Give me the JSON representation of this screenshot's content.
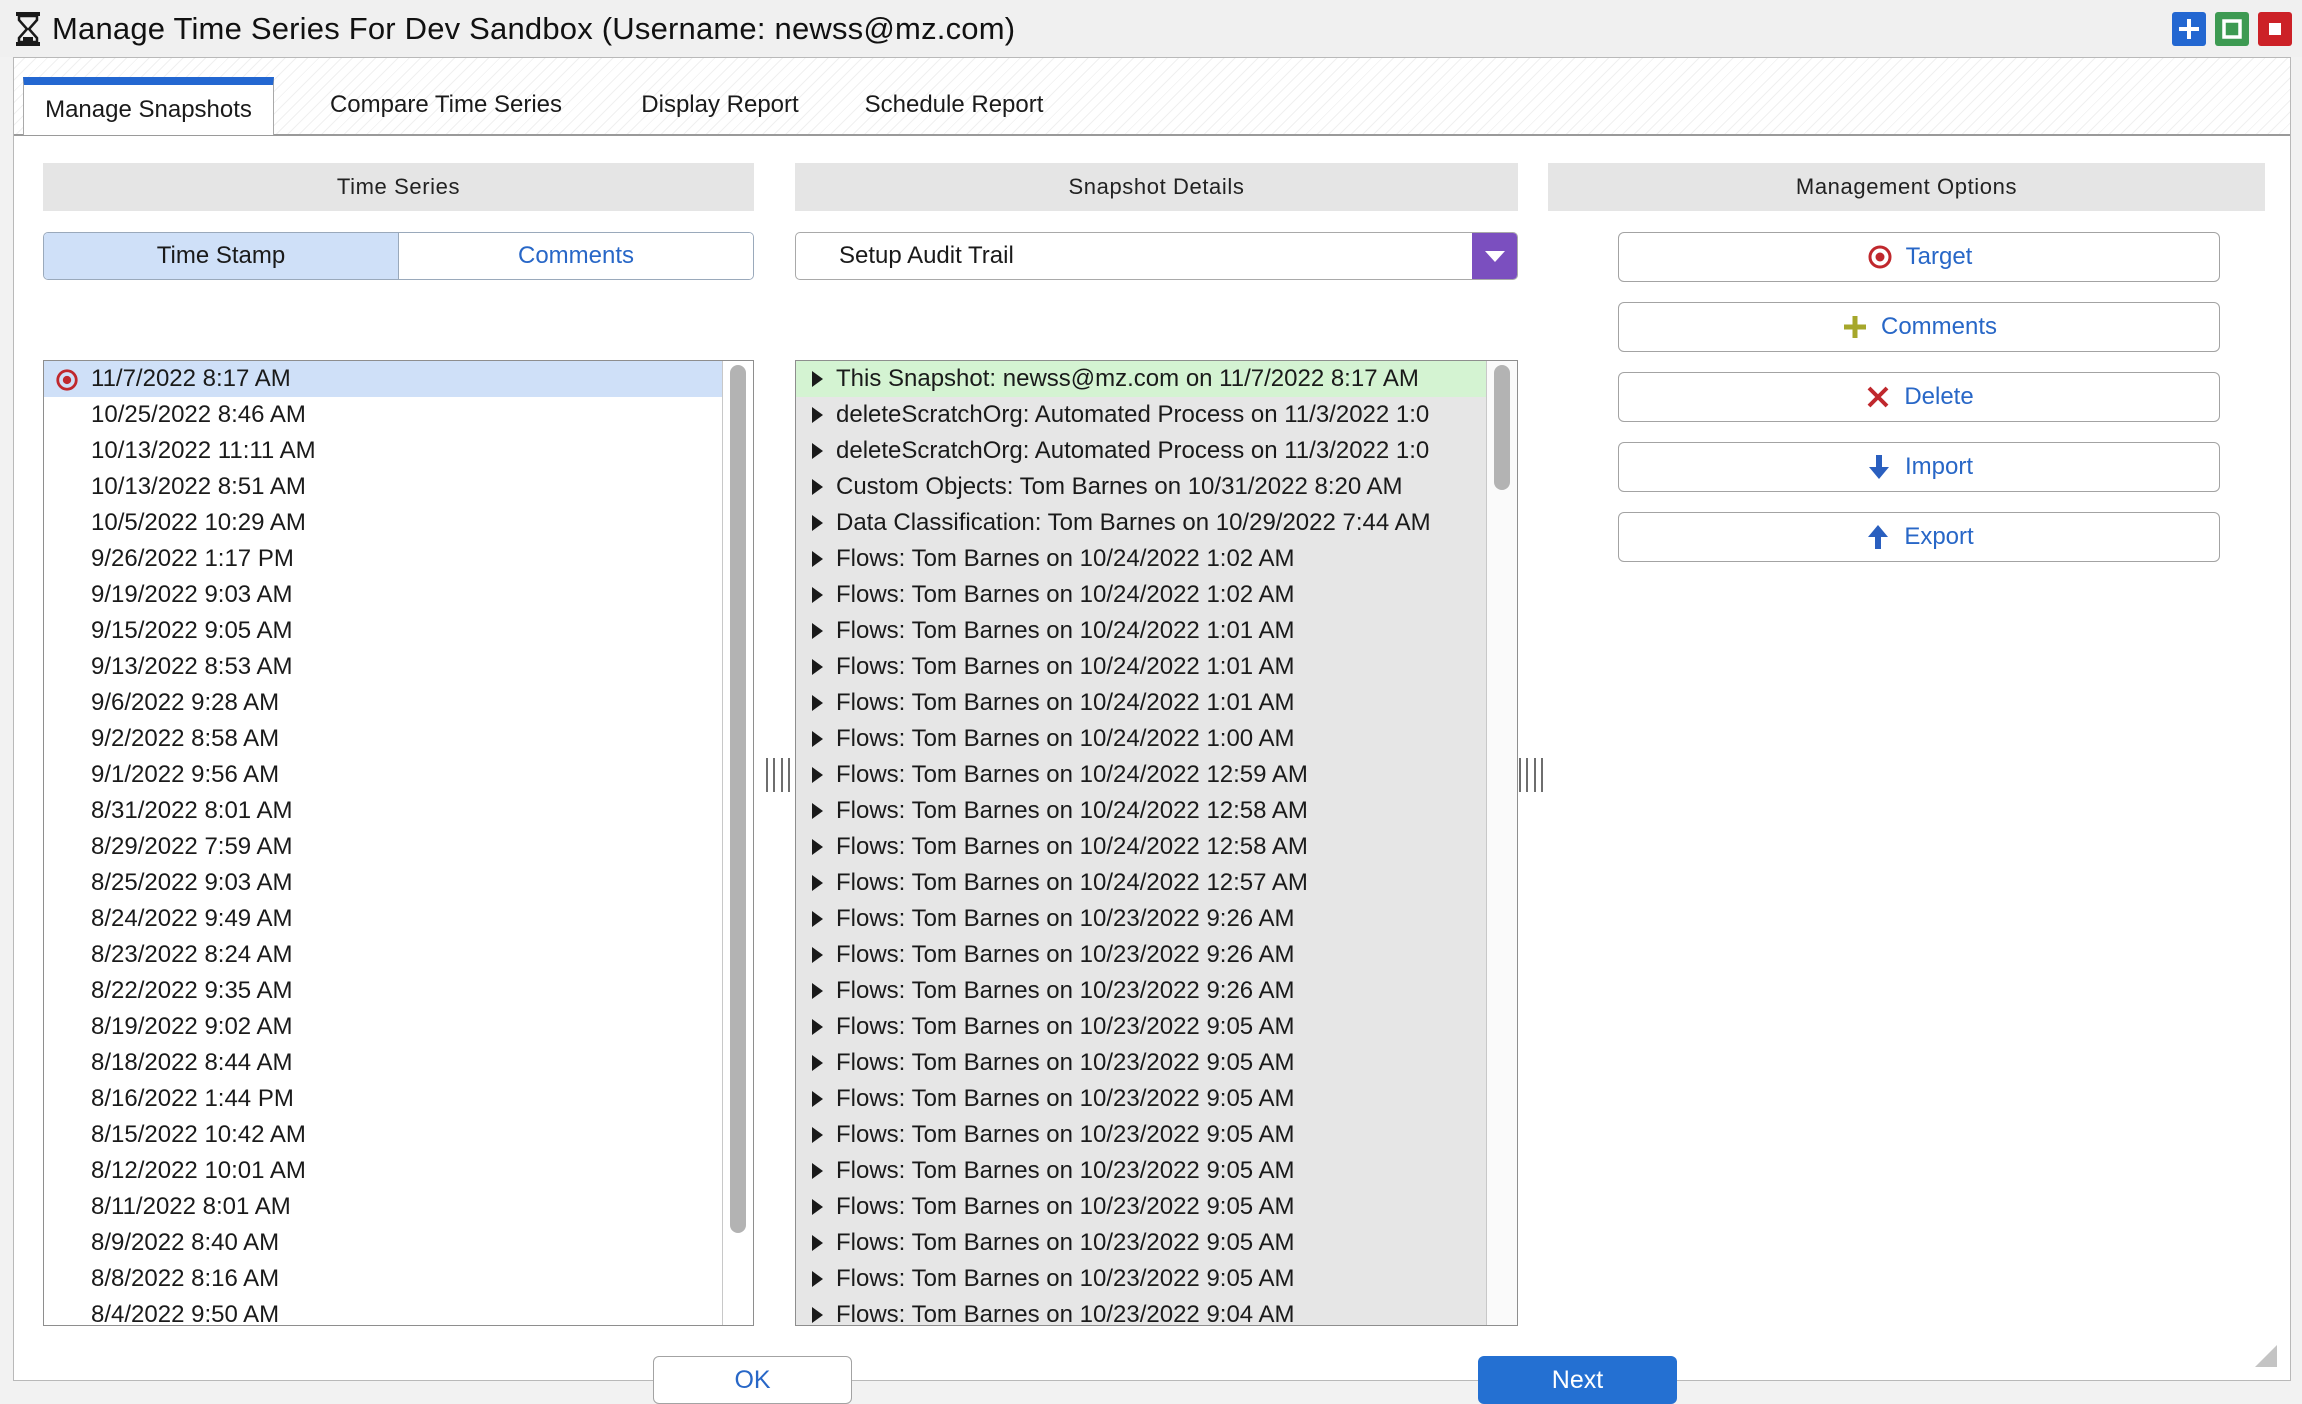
{
  "window": {
    "title": "Manage Time Series For Dev Sandbox (Username: newss@mz.com)",
    "colors": {
      "accent_blue": "#2367d1",
      "maximize_green": "#3d9a52",
      "close_red": "#cc2127",
      "dropdown_purple": "#7b4fbf"
    }
  },
  "tabs": [
    {
      "label": "Manage Snapshots",
      "active": true
    },
    {
      "label": "Compare Time Series",
      "active": false
    },
    {
      "label": "Display Report",
      "active": false
    },
    {
      "label": "Schedule Report",
      "active": false
    }
  ],
  "columns": {
    "time_series": "Time Series",
    "snapshot_details": "Snapshot Details",
    "management_options": "Management Options"
  },
  "time_series": {
    "toggle": {
      "timestamp": "Time Stamp",
      "comments": "Comments",
      "selected": "timestamp"
    },
    "items": [
      "11/7/2022 8:17 AM",
      "10/25/2022 8:46 AM",
      "10/13/2022 11:11 AM",
      "10/13/2022 8:51 AM",
      "10/5/2022 10:29 AM",
      "9/26/2022 1:17 PM",
      "9/19/2022 9:03 AM",
      "9/15/2022 9:05 AM",
      "9/13/2022 8:53 AM",
      "9/6/2022 9:28 AM",
      "9/2/2022 8:58 AM",
      "9/1/2022 9:56 AM",
      "8/31/2022 8:01 AM",
      "8/29/2022 7:59 AM",
      "8/25/2022 9:03 AM",
      "8/24/2022 9:49 AM",
      "8/23/2022 8:24 AM",
      "8/22/2022 9:35 AM",
      "8/19/2022 9:02 AM",
      "8/18/2022 8:44 AM",
      "8/16/2022 1:44 PM",
      "8/15/2022 10:42 AM",
      "8/12/2022 10:01 AM",
      "8/11/2022 8:01 AM",
      "8/9/2022 8:40 AM",
      "8/8/2022 8:16 AM",
      "8/4/2022 9:50 AM"
    ],
    "selected_index": 0,
    "scroll_thumb_fraction": 0.9
  },
  "snapshot_details": {
    "dropdown_value": "Setup Audit Trail",
    "items": [
      "This Snapshot: newss@mz.com on 11/7/2022 8:17 AM",
      "deleteScratchOrg: Automated Process on 11/3/2022 1:0",
      "deleteScratchOrg: Automated Process on 11/3/2022 1:0",
      "Custom Objects: Tom Barnes on 10/31/2022 8:20 AM",
      "Data Classification: Tom Barnes on 10/29/2022 7:44 AM",
      "Flows: Tom Barnes on 10/24/2022 1:02 AM",
      "Flows: Tom Barnes on 10/24/2022 1:02 AM",
      "Flows: Tom Barnes on 10/24/2022 1:01 AM",
      "Flows: Tom Barnes on 10/24/2022 1:01 AM",
      "Flows: Tom Barnes on 10/24/2022 1:01 AM",
      "Flows: Tom Barnes on 10/24/2022 1:00 AM",
      "Flows: Tom Barnes on 10/24/2022 12:59 AM",
      "Flows: Tom Barnes on 10/24/2022 12:58 AM",
      "Flows: Tom Barnes on 10/24/2022 12:58 AM",
      "Flows: Tom Barnes on 10/24/2022 12:57 AM",
      "Flows: Tom Barnes on 10/23/2022 9:26 AM",
      "Flows: Tom Barnes on 10/23/2022 9:26 AM",
      "Flows: Tom Barnes on 10/23/2022 9:26 AM",
      "Flows: Tom Barnes on 10/23/2022 9:05 AM",
      "Flows: Tom Barnes on 10/23/2022 9:05 AM",
      "Flows: Tom Barnes on 10/23/2022 9:05 AM",
      "Flows: Tom Barnes on 10/23/2022 9:05 AM",
      "Flows: Tom Barnes on 10/23/2022 9:05 AM",
      "Flows: Tom Barnes on 10/23/2022 9:05 AM",
      "Flows: Tom Barnes on 10/23/2022 9:05 AM",
      "Flows: Tom Barnes on 10/23/2022 9:05 AM",
      "Flows: Tom Barnes on 10/23/2022 9:04 AM"
    ],
    "scroll_thumb_fraction": 0.13
  },
  "management_options": [
    {
      "label": "Target",
      "icon": "target-icon"
    },
    {
      "label": "Comments",
      "icon": "plus-icon"
    },
    {
      "label": "Delete",
      "icon": "x-icon"
    },
    {
      "label": "Import",
      "icon": "arrow-down-icon"
    },
    {
      "label": "Export",
      "icon": "arrow-up-icon"
    }
  ],
  "footer": {
    "ok_label": "OK",
    "next_label": "Next"
  }
}
